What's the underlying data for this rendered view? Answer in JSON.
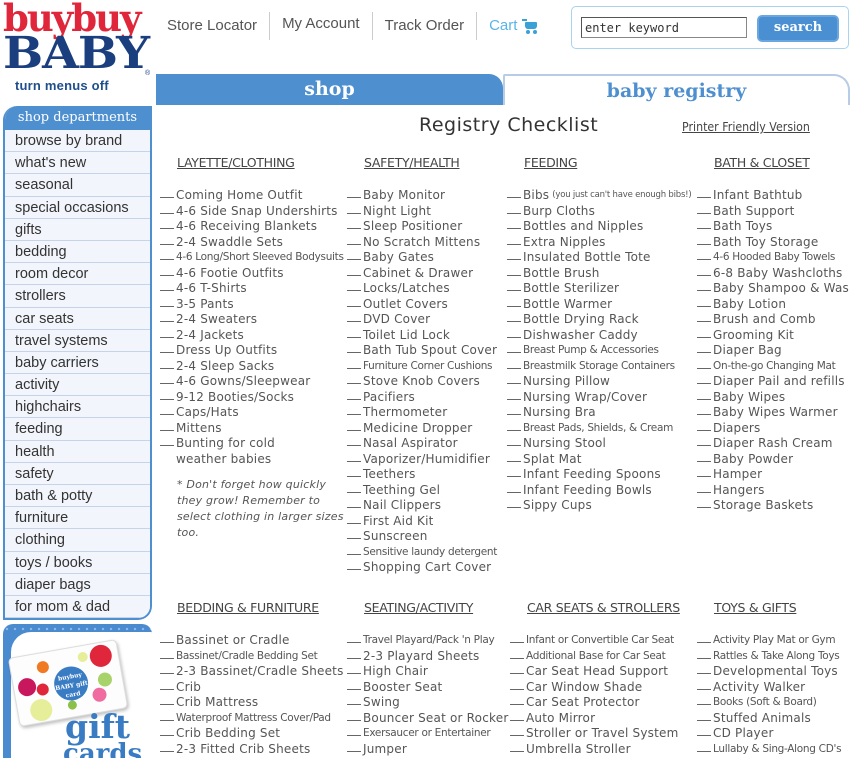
{
  "logo": {
    "line1": "buybuy",
    "line2": "BABY",
    "registered": "®"
  },
  "menus_toggle": "turn menus off",
  "topnav": {
    "store_locator": "Store Locator",
    "my_account": "My Account",
    "track_order": "Track Order",
    "cart": "Cart",
    "cart_icon": "stroller-cart-icon"
  },
  "search": {
    "placeholder": "enter keyword",
    "value": "enter keyword",
    "button": "search"
  },
  "tabs": {
    "shop": "shop",
    "registry": "baby registry",
    "active": "baby registry"
  },
  "sidebar": {
    "title": "shop departments",
    "items": [
      "browse by brand",
      "what's new",
      "seasonal",
      "special occasions",
      "gifts",
      "bedding",
      "room decor",
      "strollers",
      "car seats",
      "travel systems",
      "baby carriers",
      "activity",
      "highchairs",
      "feeding",
      "health",
      "safety",
      "bath & potty",
      "furniture",
      "clothing",
      "toys / books",
      "diaper bags",
      "for mom & dad"
    ]
  },
  "promo": {
    "card_logo": "buybuy BABY gift card",
    "text1": "gift",
    "text2": "cards"
  },
  "checklist": {
    "title": "Registry Checklist",
    "printer_link": "Printer Friendly Version",
    "sections": [
      {
        "heading": "LAYETTE/CLOTHING",
        "items": [
          "Coming Home Outfit",
          "4-6 Side Snap Undershirts",
          "4-6 Receiving Blankets",
          "2-4 Swaddle Sets",
          "4-6 Long/Short Sleeved Bodysuits",
          "4-6 Footie Outfits",
          "4-6 T-Shirts",
          "3-5 Pants",
          "2-4 Sweaters",
          "2-4 Jackets",
          "Dress Up Outfits",
          "2-4 Sleep Sacks",
          "4-6 Gowns/Sleepwear",
          "9-12 Booties/Socks",
          "Caps/Hats",
          "Mittens",
          "Bunting for cold weather babies"
        ],
        "note": "* Don't forget how quickly they grow! Remember to select clothing in larger sizes too."
      },
      {
        "heading": "SAFETY/HEALTH",
        "items": [
          "Baby Monitor",
          "Night Light",
          "Sleep Positioner",
          "No Scratch Mittens",
          "Baby Gates",
          "Cabinet & Drawer",
          "Locks/Latches",
          "Outlet Covers",
          "DVD Cover",
          "Toilet Lid Lock",
          "Bath Tub Spout Cover",
          "Furniture Corner Cushions",
          "Stove Knob Covers",
          "Pacifiers",
          "Thermometer",
          "Medicine Dropper",
          "Nasal Aspirator",
          "Vaporizer/Humidifier",
          "Teethers",
          "Teething Gel",
          "Nail Clippers",
          "First Aid Kit",
          "Sunscreen",
          "Sensitive laundy detergent",
          "Shopping Cart Cover"
        ]
      },
      {
        "heading": "FEEDING",
        "items": [
          "Bibs",
          "Burp Cloths",
          "Bottles and Nipples",
          "Extra Nipples",
          "Insulated Bottle Tote",
          "Bottle Brush",
          "Bottle Sterilizer",
          "Bottle Warmer",
          "Bottle Drying Rack",
          "Dishwasher Caddy",
          "Breast Pump & Accessories",
          "Breastmilk Storage Containers",
          "Nursing Pillow",
          "Nursing Wrap/Cover",
          "Nursing Bra",
          "Breast Pads, Shields, & Cream",
          "Nursing Stool",
          "Splat Mat",
          "Infant Feeding Spoons",
          "Infant Feeding Bowls",
          "Sippy Cups"
        ],
        "bibs_note": "(you just can't have enough bibs!)"
      },
      {
        "heading": "BATH & CLOSET",
        "items": [
          "Infant Bathtub",
          "Bath Support",
          "Bath Toys",
          "Bath Toy Storage",
          "4-6 Hooded Baby Towels",
          "6-8 Baby Washcloths",
          "Baby Shampoo & Wash",
          "Baby Lotion",
          "Brush and Comb",
          "Grooming Kit",
          "Diaper Bag",
          "On-the-go Changing Mat",
          "Diaper Pail and refills",
          "Baby Wipes",
          "Baby Wipes Warmer",
          "Diapers",
          "Diaper Rash Cream",
          "Baby Powder",
          "Hamper",
          "Hangers",
          "Storage Baskets"
        ]
      },
      {
        "heading": "BEDDING & FURNITURE",
        "items": [
          "Bassinet or Cradle",
          "Bassinet/Cradle Bedding Set",
          "2-3 Bassinet/Cradle Sheets",
          "Crib",
          "Crib Mattress",
          "Waterproof Mattress Cover/Pad",
          "Crib Bedding Set",
          "2-3 Fitted Crib Sheets"
        ]
      },
      {
        "heading": "SEATING/ACTIVITY",
        "items": [
          "Travel Playard/Pack 'n Play",
          "2-3 Playard Sheets",
          "High Chair",
          "Booster Seat",
          "Swing",
          "Bouncer Seat or Rocker",
          "Exersaucer or Entertainer",
          "Jumper"
        ]
      },
      {
        "heading": "CAR SEATS & STROLLERS",
        "items": [
          "Infant or Convertible Car Seat",
          "Additional Base for Car Seat",
          "Car Seat Head Support",
          "Car Window Shade",
          "Car Seat Protector",
          "Auto Mirror",
          "Stroller or Travel System",
          "Umbrella Stroller"
        ]
      },
      {
        "heading": "TOYS & GIFTS",
        "items": [
          "Activity Play Mat or Gym",
          "Rattles & Take Along Toys",
          "Developmental Toys",
          "Activity Walker",
          "Books (Soft & Board)",
          "Stuffed Animals",
          "CD Player",
          "Lullaby & Sing-Along CD's"
        ]
      }
    ]
  },
  "colors": {
    "brand_red": "#e0263a",
    "brand_navy": "#1b3f7e",
    "accent_blue": "#4e8fd0",
    "cart_blue": "#5ab4e6"
  }
}
